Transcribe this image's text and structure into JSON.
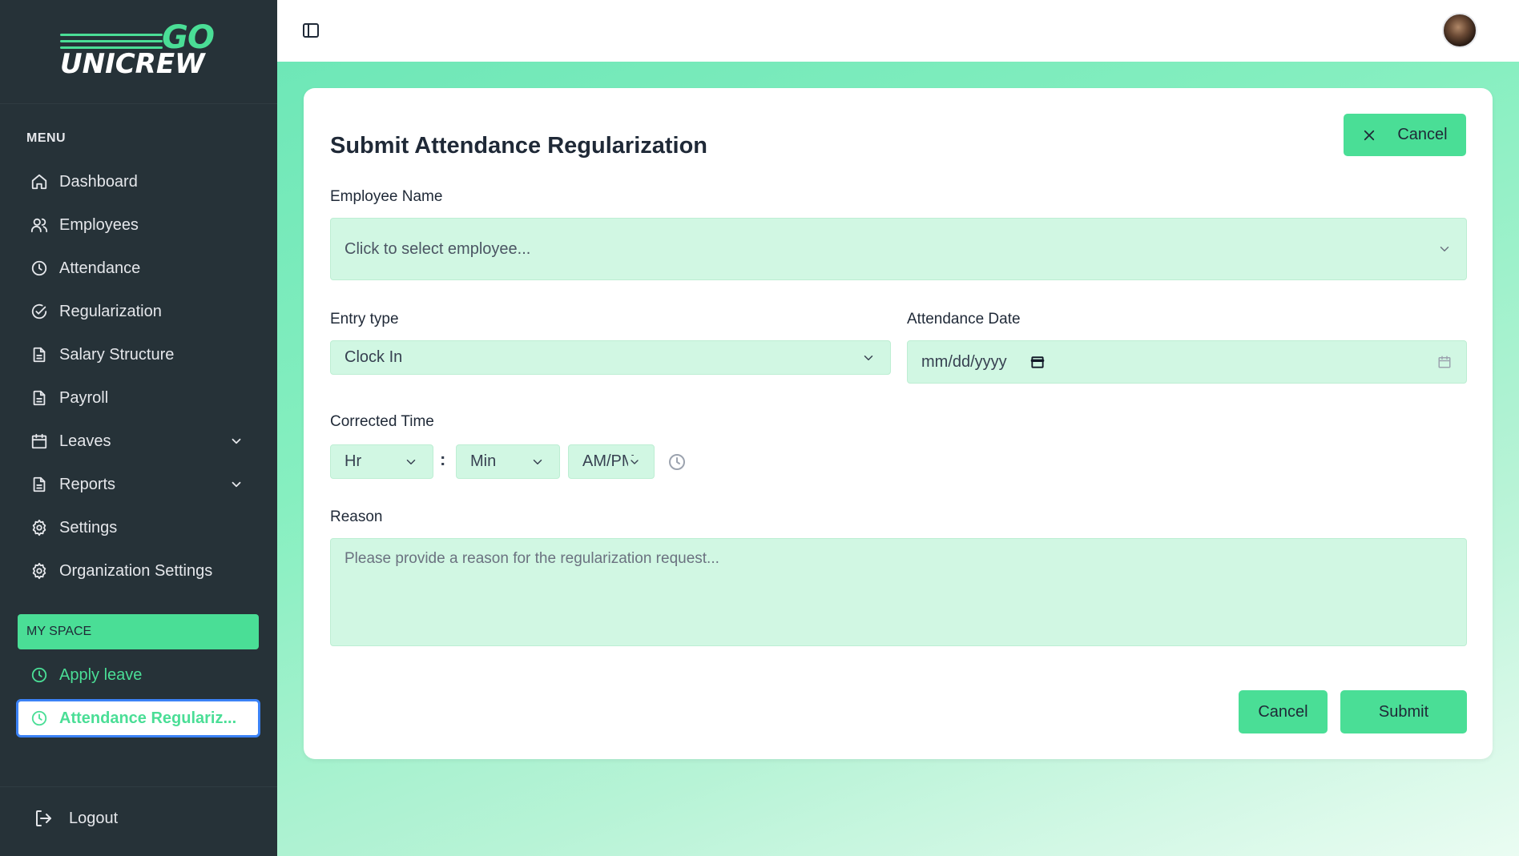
{
  "brand": {
    "go": "GO",
    "name": "UNICREW"
  },
  "sidebar": {
    "menu_title": "MENU",
    "items": [
      {
        "label": "Dashboard",
        "icon": "home-icon"
      },
      {
        "label": "Employees",
        "icon": "users-icon"
      },
      {
        "label": "Attendance",
        "icon": "clock-icon"
      },
      {
        "label": "Regularization",
        "icon": "check-circle-icon"
      },
      {
        "label": "Salary Structure",
        "icon": "document-icon"
      },
      {
        "label": "Payroll",
        "icon": "document-icon"
      },
      {
        "label": "Leaves",
        "icon": "calendar-icon",
        "expandable": true
      },
      {
        "label": "Reports",
        "icon": "document-icon",
        "expandable": true
      },
      {
        "label": "Settings",
        "icon": "gear-icon"
      },
      {
        "label": "Organization Settings",
        "icon": "gear-icon"
      }
    ],
    "my_space": {
      "title": "MY SPACE",
      "items": [
        {
          "label": "Apply leave",
          "icon": "clock-icon"
        },
        {
          "label": "Attendance Regulariz...",
          "icon": "clock-icon",
          "active": true
        }
      ]
    },
    "logout": "Logout"
  },
  "form": {
    "title": "Submit Attendance Regularization",
    "cancel_top": "Cancel",
    "employee_label": "Employee Name",
    "employee_placeholder": "Click to select employee...",
    "entry_type_label": "Entry type",
    "entry_type_value": "Clock In",
    "date_label": "Attendance Date",
    "date_placeholder": "mm/dd/yyyy",
    "time_label": "Corrected Time",
    "hour_placeholder": "Hr",
    "minute_placeholder": "Min",
    "ampm_placeholder": "AM/PM",
    "time_separator": ":",
    "reason_label": "Reason",
    "reason_placeholder": "Please provide a reason for the regularization request...",
    "cancel_button": "Cancel",
    "submit_button": "Submit"
  },
  "colors": {
    "sidebar_bg": "#263238",
    "accent": "#4ade96",
    "field_bg": "#d1f7e3",
    "active_border": "#3b82f6"
  }
}
